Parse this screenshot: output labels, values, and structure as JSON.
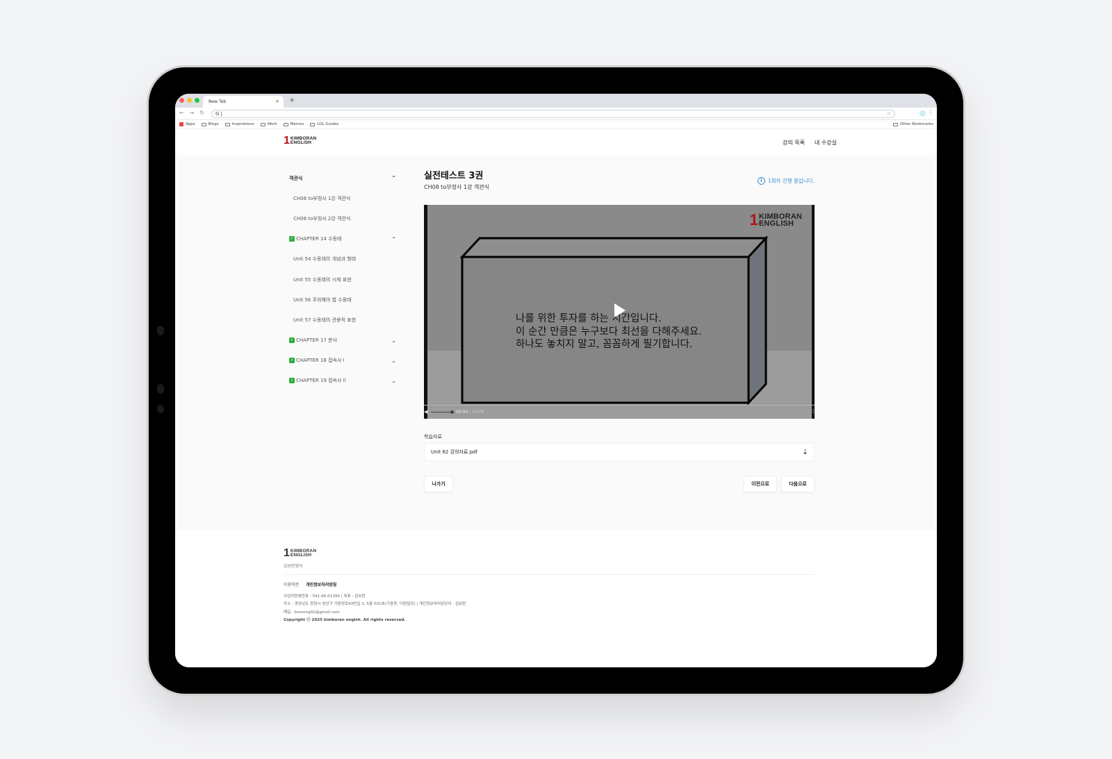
{
  "browser": {
    "tab_title": "New Tab",
    "tab_close": "×",
    "new_tab": "+",
    "address_value": "G |",
    "bookmarks": [
      "Apps",
      "Blogs",
      "Inspirations",
      "Work",
      "Memes",
      "LOL Guides"
    ],
    "other_bookmarks": "Other Bookmarks"
  },
  "logo": {
    "one": "1",
    "line1": "KIMBORAN",
    "line2": "ENGLISH"
  },
  "nav": {
    "lecture_list": "강의 목록",
    "my_classroom": "내 수강실"
  },
  "sidebar": {
    "group_label": "객관식",
    "items": [
      {
        "label": "CH08 to부정사 1강 객관식",
        "type": "sub"
      },
      {
        "label": "CH08 to부정사 2강 객관식",
        "type": "sub"
      },
      {
        "label": "CHAPTER 14 수동태",
        "type": "chapter",
        "checked": true,
        "expanded": true
      },
      {
        "label": "Unit 54 수동태의 개념과 형태",
        "type": "sub"
      },
      {
        "label": "Unit 55 수동태의 시제 표현",
        "type": "sub"
      },
      {
        "label": "Unit 56 주의해야 할 수동태",
        "type": "sub"
      },
      {
        "label": "Unit 57 수동태의 관용적 표현",
        "type": "sub"
      },
      {
        "label": "CHAPTER 17 분사",
        "type": "chapter",
        "checked": true,
        "expanded": false
      },
      {
        "label": "CHAPTER 18 접속사 I",
        "type": "chapter",
        "checked": true,
        "expanded": false
      },
      {
        "label": "CHAPTER 19 접속사 II",
        "type": "chapter",
        "checked": true,
        "expanded": false
      }
    ]
  },
  "lesson": {
    "title": "실전테스트 3권",
    "subtitle": "CH08 to부정사 1강 객관식",
    "progress_note": "1회차 진행 중입니다."
  },
  "video": {
    "overlay_lines": [
      "나를 위한 투자를 하는 시간입니다.",
      "이 순간 만큼은 누구보다 최선을 다해주세요.",
      "하나도 놓치지 말고, 꼼꼼하게 필기합니다."
    ],
    "current_time": "00:00",
    "duration": "24:09"
  },
  "materials": {
    "label": "학습자료",
    "file_name": "Unit 62 강의자료.pdf"
  },
  "buttons": {
    "exit": "나가기",
    "prev": "이전으로",
    "next": "다음으로"
  },
  "footer": {
    "brand_korean": "김보란영어",
    "terms": "이용약관",
    "privacy": "개인정보처리방침",
    "business_info": "사업자등록번호 : 541-96-01390 | 대표 : 김보란",
    "address": "주소 : 경상남도 창원시 성산구 가음정로43번길 3, 5층 501호(가음동, 더원빌딩) | 개인정보처리담당자 : 김보란",
    "email": "메일 : bomong92@gmail.com",
    "copyright": "Copyright ⓒ 2025 kimboran englsh. All rights reserved."
  },
  "colors": {
    "brand_red": "#b31414",
    "info_blue": "#3a8fd6",
    "check_green": "#2eae3e"
  },
  "icons": [
    "chevron-up-icon",
    "chevron-down-icon",
    "check-icon",
    "info-icon",
    "play-icon",
    "volume-icon",
    "download-icon",
    "star-icon",
    "folder-icon"
  ]
}
